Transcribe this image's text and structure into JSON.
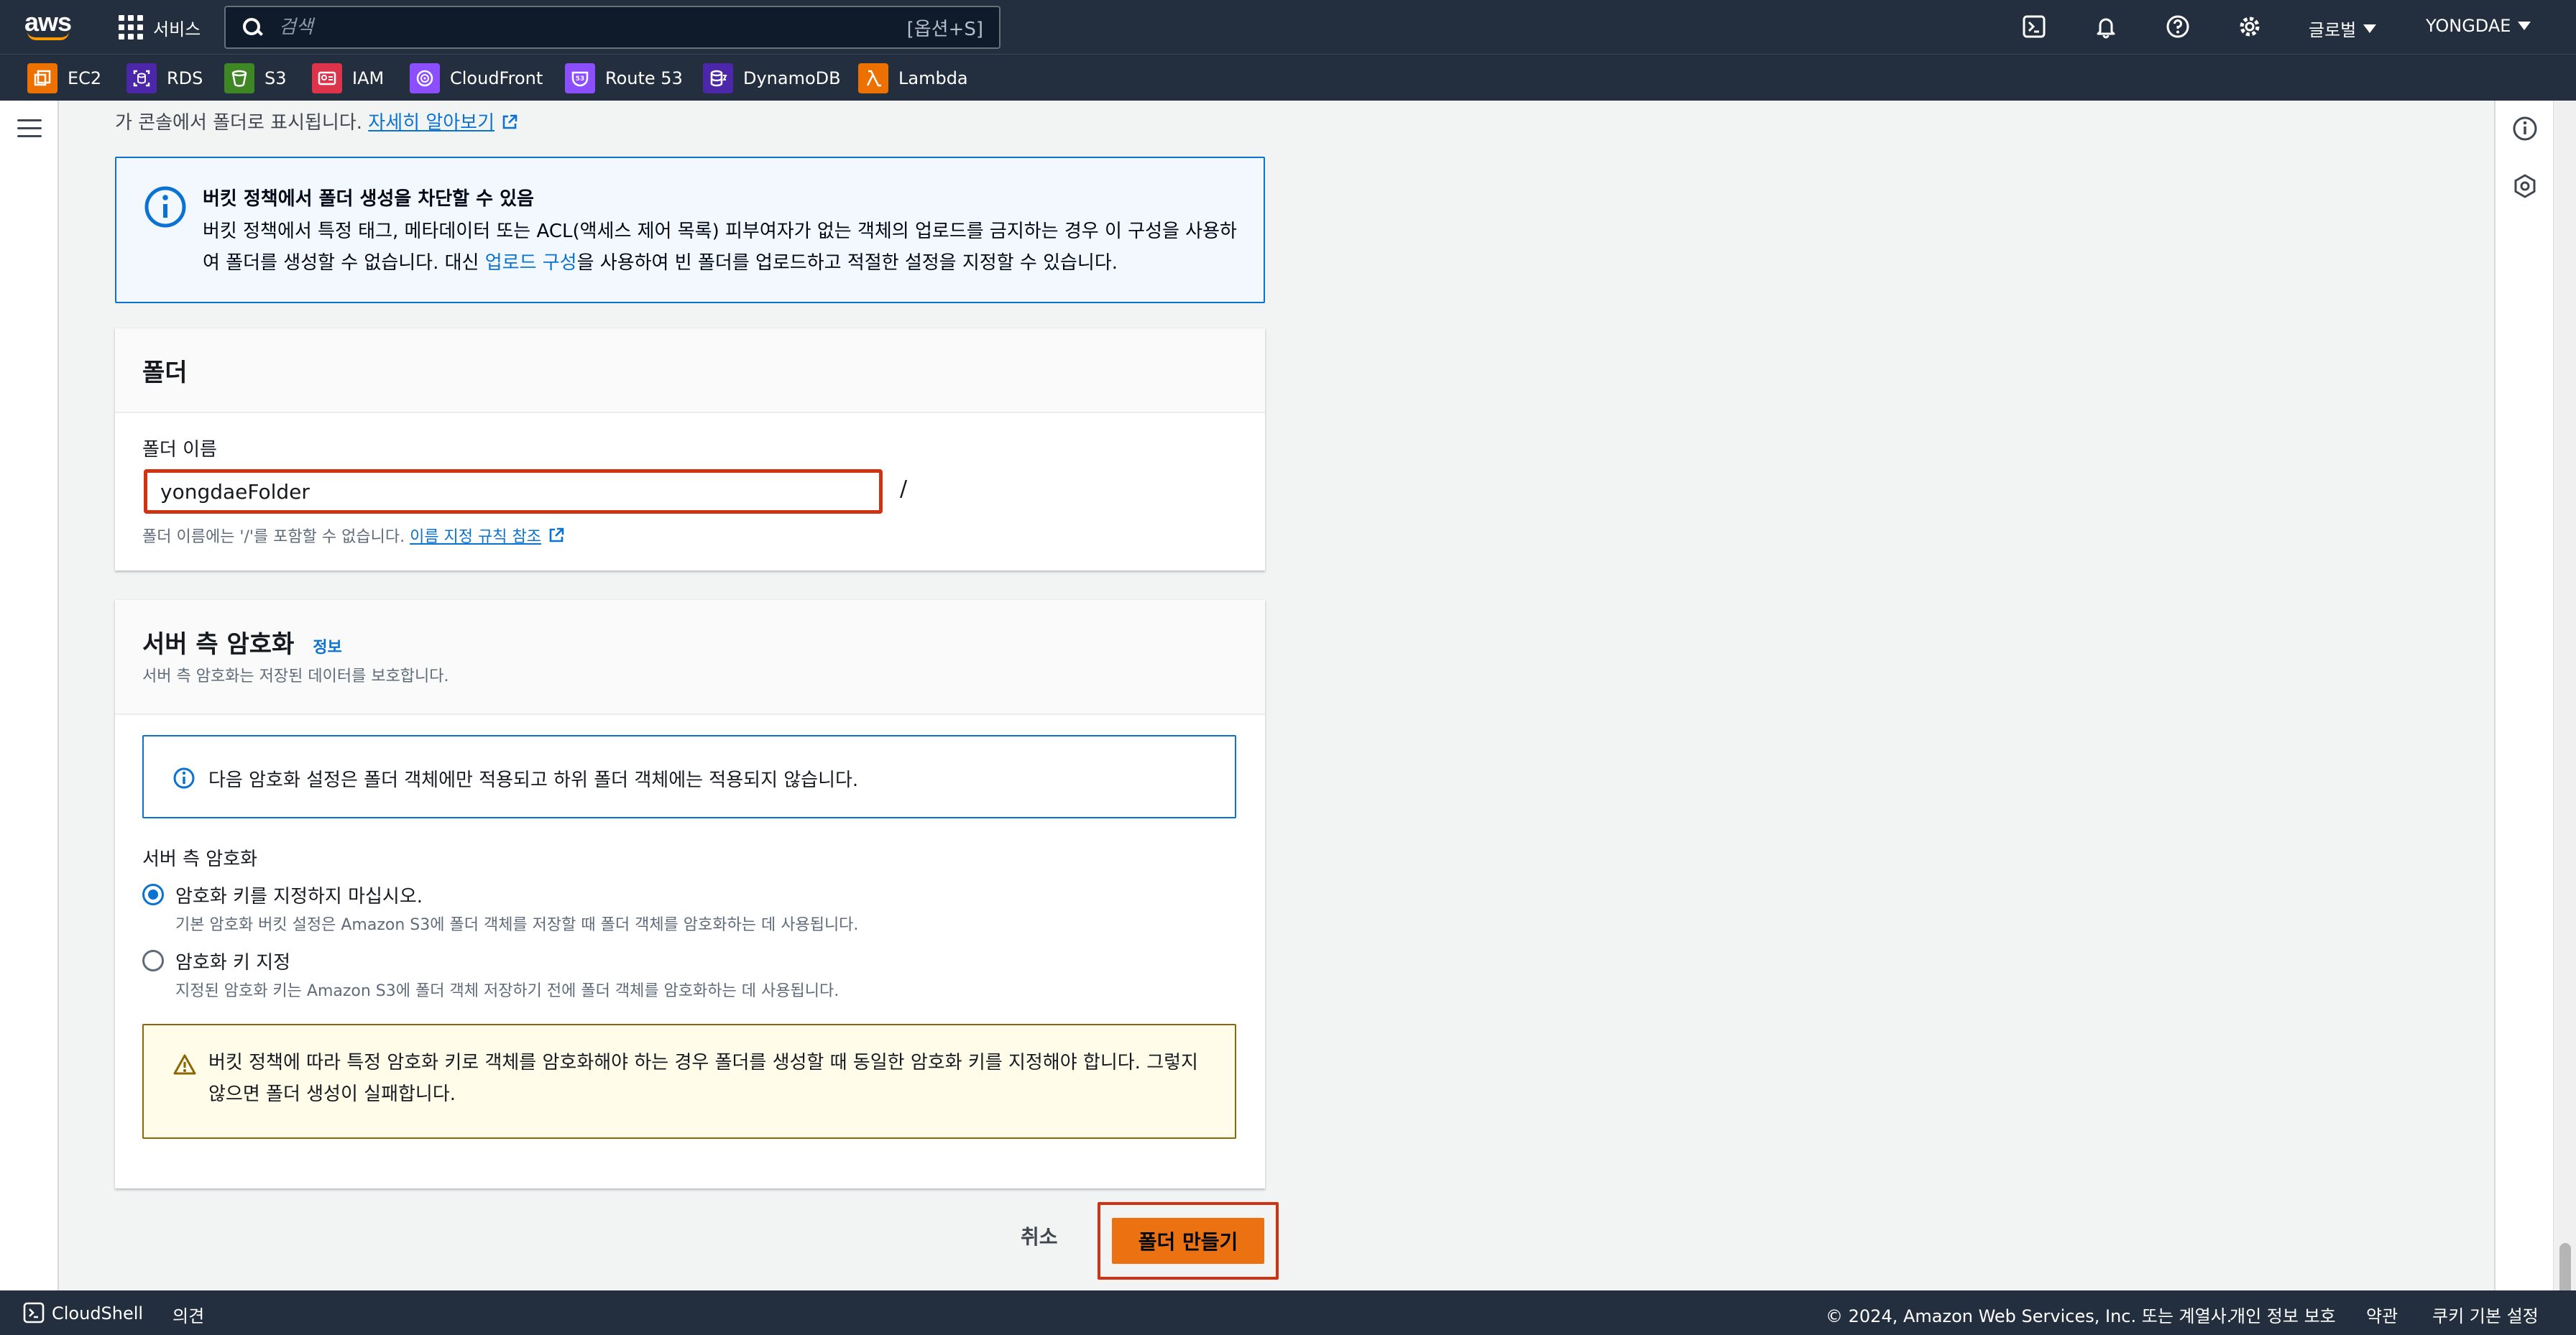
{
  "topnav": {
    "logo_text": "aws",
    "services_label": "서비스",
    "search_placeholder": "검색",
    "search_shortcut": "[옵션+S]",
    "region_label": "글로벌",
    "user_label": "YONGDAE",
    "icons": [
      "cloudshell-icon",
      "bell-icon",
      "help-icon",
      "gear-icon"
    ]
  },
  "favorites": [
    {
      "label": "EC2",
      "color": "#ed7100",
      "icon": "ec2-icon"
    },
    {
      "label": "RDS",
      "color": "#4d27aa",
      "icon": "rds-icon"
    },
    {
      "label": "S3",
      "color": "#3f8624",
      "icon": "s3-icon"
    },
    {
      "label": "IAM",
      "color": "#dd344c",
      "icon": "iam-icon"
    },
    {
      "label": "CloudFront",
      "color": "#8c4fff",
      "icon": "cloudfront-icon"
    },
    {
      "label": "Route 53",
      "color": "#8c4fff",
      "icon": "route53-icon"
    },
    {
      "label": "DynamoDB",
      "color": "#4d27aa",
      "icon": "dynamodb-icon"
    },
    {
      "label": "Lambda",
      "color": "#ed7100",
      "icon": "lambda-icon"
    }
  ],
  "intro": {
    "text": "가 콘솔에서 폴더로 표시됩니다.",
    "link": "자세히 알아보기"
  },
  "bucket_alert": {
    "title": "버킷 정책에서 폴더 생성을 차단할 수 있음",
    "body_1": "버킷 정책에서 특정 태그, 메타데이터 또는 ACL(액세스 제어 목록) 피부여자가 없는 객체의 업로드를 금지하는 경우 이 구성을 사용하여 폴더를 생성할 수 없습니다. 대신 ",
    "body_link": "업로드 구성",
    "body_2": "을 사용하여 빈 폴더를 업로드하고 적절한 설정을 지정할 수 있습니다."
  },
  "folder_panel": {
    "title": "폴더",
    "name_label": "폴더 이름",
    "name_value": "yongdaeFolder",
    "slash": "/",
    "hint_text": "폴더 이름에는 '/'를 포함할 수 없습니다.",
    "hint_link": "이름 지정 규칙 참조"
  },
  "encryption_panel": {
    "title": "서버 측 암호화",
    "info_link": "정보",
    "subtitle": "서버 측 암호화는 저장된 데이터를 보호합니다.",
    "info_alert": "다음 암호화 설정은 폴더 객체에만 적용되고 하위 폴더 객체에는 적용되지 않습니다.",
    "group_label": "서버 측 암호화",
    "options": [
      {
        "label": "암호화 키를 지정하지 마십시오.",
        "description": "기본 암호화 버킷 설정은 Amazon S3에 폴더 객체를 저장할 때 폴더 객체를 암호화하는 데 사용됩니다.",
        "selected": true
      },
      {
        "label": "암호화 키 지정",
        "description": "지정된 암호화 키는 Amazon S3에 폴더 객체 저장하기 전에 폴더 객체를 암호화하는 데 사용됩니다.",
        "selected": false
      }
    ],
    "warning": "버킷 정책에 따라 특정 암호화 키로 객체를 암호화해야 하는 경우 폴더를 생성할 때 동일한 암호화 키를 지정해야 합니다. 그렇지 않으면 폴더 생성이 실패합니다."
  },
  "actions": {
    "cancel": "취소",
    "create": "폴더 만들기"
  },
  "footer": {
    "cloudshell": "CloudShell",
    "feedback": "의견",
    "copyright": "© 2024, Amazon Web Services, Inc. 또는 계열사.",
    "privacy": "개인 정보 보호",
    "terms": "약관",
    "cookies": "쿠키 기본 설정"
  },
  "colors": {
    "nav_bg": "#232f3e",
    "link": "#0972d3",
    "primary_button": "#ec7211",
    "highlight_border": "#d13212"
  }
}
